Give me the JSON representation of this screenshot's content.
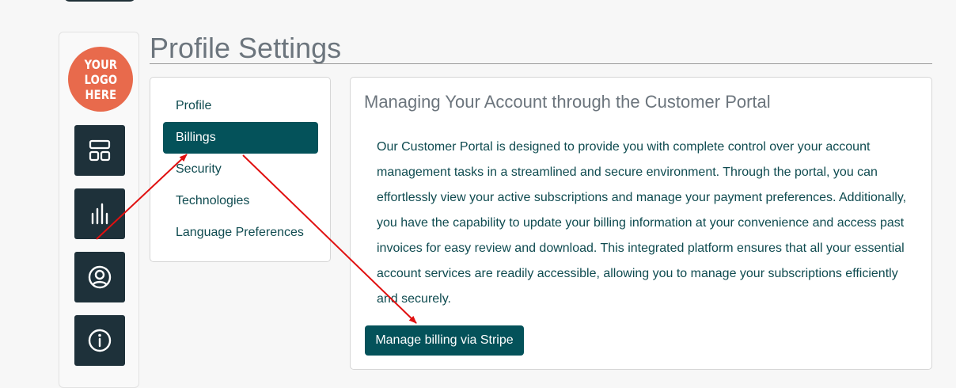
{
  "sidebar": {
    "logo_text": "YOUR\nLOGO\nHERE",
    "logo_color": "#e86a4c",
    "nav_buttons": [
      {
        "icon": "dashboard-icon"
      },
      {
        "icon": "bar-chart-icon"
      },
      {
        "icon": "user-circle-icon"
      },
      {
        "icon": "info-icon"
      }
    ]
  },
  "page": {
    "title": "Profile Settings"
  },
  "settings_menu": {
    "items": [
      {
        "label": "Profile"
      },
      {
        "label": "Billings",
        "active": true
      },
      {
        "label": "Security"
      },
      {
        "label": "Technologies"
      },
      {
        "label": "Language Preferences"
      }
    ]
  },
  "billing": {
    "title": "Managing Your Account through the Customer Portal",
    "body": "Our Customer Portal is designed to provide you with complete control over your account management tasks in a streamlined and secure environment. Through the portal, you can effortlessly view your active subscriptions and manage your payment preferences. Additionally, you have the capability to update your billing information at your convenience and access past invoices for easy review and download. This integrated platform ensures that all your essential account services are readily accessible, allowing you to manage your subscriptions efficiently and securely.",
    "button_label": "Manage billing via Stripe"
  },
  "theme": {
    "primary": "#04525a",
    "sidebar_button": "#1e313a",
    "annotation_arrow": "#e01010"
  }
}
